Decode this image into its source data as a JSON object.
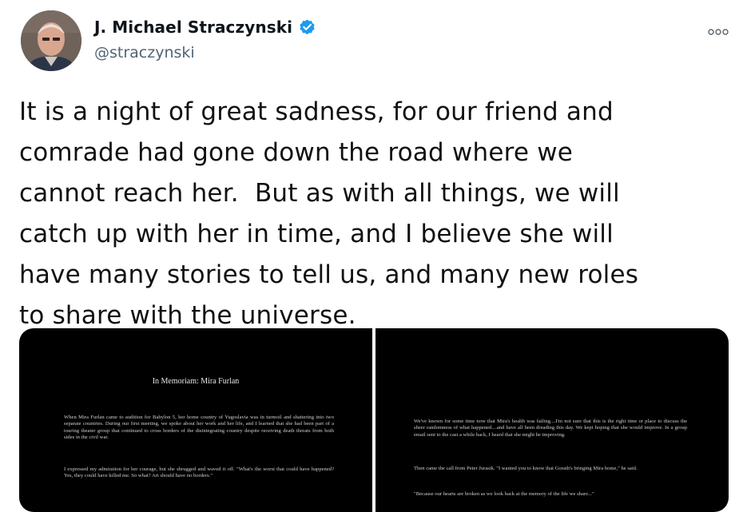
{
  "tweet": {
    "author_name": "J. Michael Straczynski",
    "handle": "@straczynski",
    "text": "It is a night of great sadness, for our friend and\ncomrade had gone down the road where we\ncannot reach her.  But as with all things, we will\ncatch up with her in time, and I believe she will\nhave many stories to tell us, and many new roles\nto share with the universe.",
    "verified_color": "#1d9bf0",
    "icons": [
      "avatar",
      "verified-badge-icon",
      "more-options-icon"
    ]
  },
  "media": {
    "left_page": {
      "title": "In Memoriam: Mira Furlan",
      "para1": "When Mira Furlan came to audition for Babylon 5, her home country of Yugoslavia was in turmoil and shattering into two separate countries. During our first meeting, we spoke about her work and her life, and I learned that she had been part of a touring theater group that continued to cross borders of the disintegrating country despite receiving death threats from both sides in the civil war.",
      "para2": "I expressed my admiration for her courage, but she shrugged and waved it off. \"What's the worst that could have happened? Yes, they could have killed me. So what? Art should have no borders.\""
    },
    "right_page": {
      "para1": "We've known for some time now that Mira's health was failing....I'm not sure that this is the right time or place to discuss the sheer randomness of what happened....and have all been dreading this day. We kept hoping that she would improve. In a group email sent to the cast a while back, I heard that she might be improving.",
      "para2": "Then came the call from Peter Jurasik. \"I wanted you to know that Gorath's bringing Mira home,\" he said.",
      "para3": "\"Because our hearts are broken as we look back at the memory of the life we share...\""
    }
  }
}
